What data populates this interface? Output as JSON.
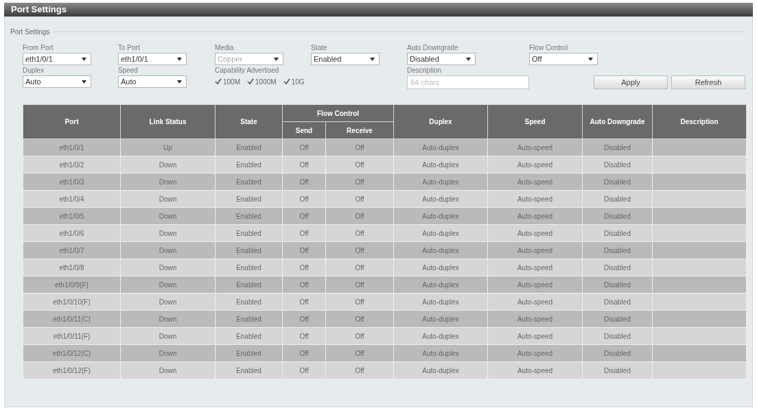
{
  "window": {
    "title": "Port Settings"
  },
  "panel": {
    "legend": "Port Settings",
    "fields": [
      {
        "kind": "select",
        "label": "From Port",
        "value": "eth1/0/1",
        "disabled": false
      },
      {
        "kind": "select",
        "label": "To Port",
        "value": "eth1/0/1",
        "disabled": false
      },
      {
        "kind": "select",
        "label": "Media",
        "value": "Copper",
        "disabled": true
      },
      {
        "kind": "select",
        "label": "State",
        "value": "Enabled",
        "disabled": false
      },
      {
        "kind": "select",
        "label": "Auto Downgrade",
        "value": "Disabled",
        "disabled": false
      },
      {
        "kind": "select",
        "label": "Flow Control",
        "value": "Off",
        "disabled": false
      },
      {
        "kind": "select",
        "label": "Duplex",
        "value": "Auto",
        "disabled": false
      },
      {
        "kind": "select",
        "label": "Speed",
        "value": "Auto",
        "disabled": false
      },
      {
        "kind": "checkboxes",
        "label": "Capability Advertised",
        "options": [
          {
            "label": "100M",
            "checked": true
          },
          {
            "label": "1000M",
            "checked": true
          },
          {
            "label": "10G",
            "checked": true
          }
        ]
      },
      {
        "kind": "text",
        "label": "Description",
        "placeholder": "64 chars"
      }
    ],
    "buttons": [
      "Apply",
      "Refresh"
    ]
  },
  "table": {
    "columns": [
      {
        "label": "Port"
      },
      {
        "label": "Link Status"
      },
      {
        "label": "State"
      },
      {
        "label": "Flow Control",
        "colspan": 2,
        "children": [
          "Send",
          "Receive"
        ]
      },
      {
        "label": "Duplex"
      },
      {
        "label": "Speed"
      },
      {
        "label": "Auto Downgrade"
      },
      {
        "label": "Description"
      }
    ],
    "rows": [
      [
        "eth1/0/1",
        "Up",
        "Enabled",
        "Off",
        "Off",
        "Auto-duplex",
        "Auto-speed",
        "Disabled"
      ],
      [
        "eth1/0/2",
        "Down",
        "Enabled",
        "Off",
        "Off",
        "Auto-duplex",
        "Auto-speed",
        "Disabled"
      ],
      [
        "eth1/0/3",
        "Down",
        "Enabled",
        "Off",
        "Off",
        "Auto-duplex",
        "Auto-speed",
        "Disabled"
      ],
      [
        "eth1/0/4",
        "Down",
        "Enabled",
        "Off",
        "Off",
        "Auto-duplex",
        "Auto-speed",
        "Disabled"
      ],
      [
        "eth1/0/5",
        "Down",
        "Enabled",
        "Off",
        "Off",
        "Auto-duplex",
        "Auto-speed",
        "Disabled"
      ],
      [
        "eth1/0/6",
        "Down",
        "Enabled",
        "Off",
        "Off",
        "Auto-duplex",
        "Auto-speed",
        "Disabled"
      ],
      [
        "eth1/0/7",
        "Down",
        "Enabled",
        "Off",
        "Off",
        "Auto-duplex",
        "Auto-speed",
        "Disabled"
      ],
      [
        "eth1/0/8",
        "Down",
        "Enabled",
        "Off",
        "Off",
        "Auto-duplex",
        "Auto-speed",
        "Disabled"
      ],
      [
        "eth1/0/9(F)",
        "Down",
        "Enabled",
        "Off",
        "Off",
        "Auto-duplex",
        "Auto-speed",
        "Disabled"
      ],
      [
        "eth1/0/10(F)",
        "Down",
        "Enabled",
        "Off",
        "Off",
        "Auto-duplex",
        "Auto-speed",
        "Disabled"
      ],
      [
        "eth1/0/11(C)",
        "Down",
        "Enabled",
        "Off",
        "Off",
        "Auto-duplex",
        "Auto-speed",
        "Disabled"
      ],
      [
        "eth1/0/11(F)",
        "Down",
        "Enabled",
        "Off",
        "Off",
        "Auto-duplex",
        "Auto-speed",
        "Disabled"
      ],
      [
        "eth1/0/12(C)",
        "Down",
        "Enabled",
        "Off",
        "Off",
        "Auto-duplex",
        "Auto-speed",
        "Disabled"
      ],
      [
        "eth1/0/12(F)",
        "Down",
        "Enabled",
        "Off",
        "Off",
        "Auto-duplex",
        "Auto-speed",
        "Disabled"
      ]
    ]
  }
}
